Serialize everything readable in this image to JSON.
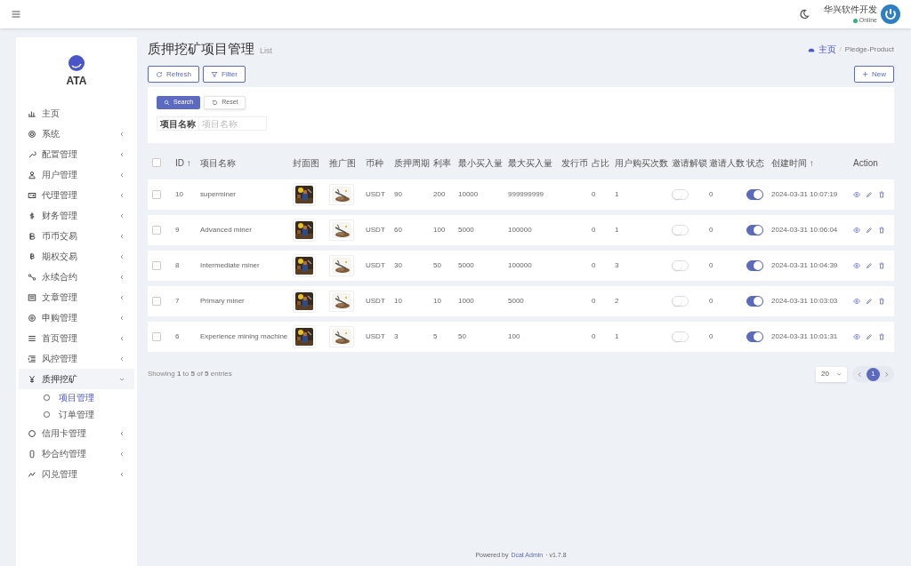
{
  "topbar": {
    "user_name": "华兴软件开发",
    "user_status": "Online"
  },
  "brand": {
    "name": "ATA"
  },
  "sidebar": {
    "items": [
      {
        "label": "主页",
        "selected": false
      },
      {
        "label": "系统",
        "selected": false,
        "expanded": false
      },
      {
        "label": "配置管理",
        "selected": false,
        "expanded": false
      },
      {
        "label": "用户管理",
        "selected": false,
        "expanded": false
      },
      {
        "label": "代理管理",
        "selected": false,
        "expanded": false
      },
      {
        "label": "财务管理",
        "selected": false,
        "expanded": false
      },
      {
        "label": "币币交易",
        "selected": false,
        "expanded": false
      },
      {
        "label": "期权交易",
        "selected": false,
        "expanded": false
      },
      {
        "label": "永续合约",
        "selected": false,
        "expanded": false
      },
      {
        "label": "文章管理",
        "selected": false,
        "expanded": false
      },
      {
        "label": "申购管理",
        "selected": false,
        "expanded": false
      },
      {
        "label": "首页管理",
        "selected": false,
        "expanded": false
      },
      {
        "label": "风控管理",
        "selected": false,
        "expanded": false
      },
      {
        "label": "质押挖矿",
        "selected": true,
        "expanded": true,
        "children": [
          {
            "label": "项目管理",
            "selected": true
          },
          {
            "label": "订单管理",
            "selected": false
          }
        ]
      },
      {
        "label": "信用卡管理",
        "selected": false,
        "expanded": false
      },
      {
        "label": "秒合约管理",
        "selected": false,
        "expanded": false
      },
      {
        "label": "闪兑管理",
        "selected": false,
        "expanded": false
      }
    ]
  },
  "page": {
    "title": "质押挖矿项目管理",
    "subtitle": "List",
    "breadcrumb": {
      "items": [
        "主页",
        "Pledge-Product"
      ],
      "separator": "/"
    }
  },
  "toolbar": {
    "buttons": [
      "Refresh",
      "Filter"
    ],
    "new_button": "New"
  },
  "filter": {
    "search_button": "Search",
    "reset_button": "Reset",
    "field_label": "项目名称",
    "placeholder": "项目名称"
  },
  "table": {
    "select_all_checked": false,
    "columns": [
      "ID ↑",
      "项目名称",
      "封面图",
      "推广图",
      "币种",
      "质押周期",
      "利率",
      "最小买入量",
      "最大买入量",
      "发行币",
      "占比",
      "用户购买次数",
      "邀请解锁",
      "邀请人数",
      "状态",
      "创建时间 ↑",
      "Action"
    ],
    "rows": [
      {
        "checked": false,
        "id": "10",
        "name": "superminer",
        "coin": "USDT",
        "period": "90",
        "rate": "200",
        "min_buy": "10000",
        "max_buy": "999999999",
        "ratio": "0",
        "buy_count": "1",
        "invite_unlock": false,
        "invite_count": "0",
        "status": true,
        "created": "2024-03-31 10:07:19"
      },
      {
        "checked": false,
        "id": "9",
        "name": "Advanced miner",
        "coin": "USDT",
        "period": "60",
        "rate": "100",
        "min_buy": "5000",
        "max_buy": "100000",
        "ratio": "0",
        "buy_count": "1",
        "invite_unlock": false,
        "invite_count": "0",
        "status": true,
        "created": "2024-03-31 10:06:04"
      },
      {
        "checked": false,
        "id": "8",
        "name": "Intermediate miner",
        "coin": "USDT",
        "period": "30",
        "rate": "50",
        "min_buy": "5000",
        "max_buy": "100000",
        "ratio": "0",
        "buy_count": "3",
        "invite_unlock": false,
        "invite_count": "0",
        "status": true,
        "created": "2024-03-31 10:04:39"
      },
      {
        "checked": false,
        "id": "7",
        "name": "Primary miner",
        "coin": "USDT",
        "period": "10",
        "rate": "10",
        "min_buy": "1000",
        "max_buy": "5000",
        "ratio": "0",
        "buy_count": "2",
        "invite_unlock": false,
        "invite_count": "0",
        "status": true,
        "created": "2024-03-31 10:03:03"
      },
      {
        "checked": false,
        "id": "6",
        "name": "Experience mining machine",
        "coin": "USDT",
        "period": "3",
        "rate": "5",
        "min_buy": "50",
        "max_buy": "100",
        "ratio": "0",
        "buy_count": "1",
        "invite_unlock": false,
        "invite_count": "0",
        "status": true,
        "created": "2024-03-31 10:01:31"
      }
    ]
  },
  "summary": "Showing **1** to **5** of **5** entries",
  "pagination": {
    "per_page": "20",
    "pages": [
      {
        "label": "1",
        "selected": true
      }
    ]
  },
  "footer": {
    "prefix": "Powered by",
    "link": "Dcat Admin",
    "version": "· v1.7.8"
  }
}
